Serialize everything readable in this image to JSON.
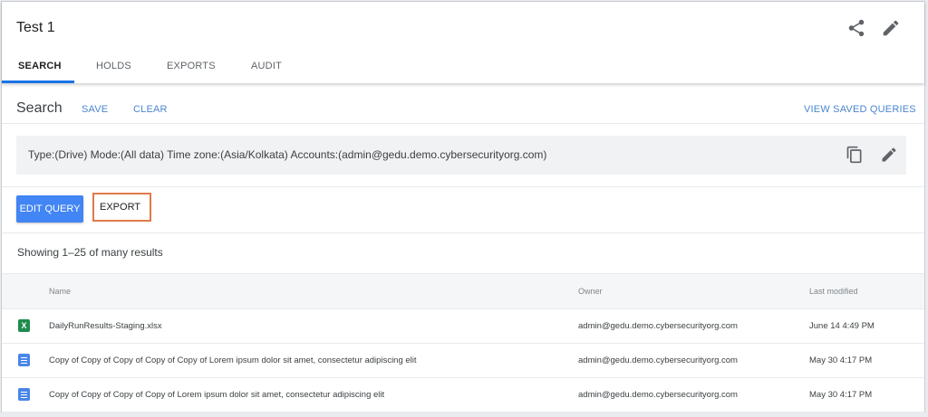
{
  "header": {
    "title": "Test 1",
    "icons": {
      "share": "share-icon",
      "edit": "pencil-icon"
    }
  },
  "tabs": [
    {
      "label": "SEARCH",
      "active": true
    },
    {
      "label": "HOLDS",
      "active": false
    },
    {
      "label": "EXPORTS",
      "active": false
    },
    {
      "label": "AUDIT",
      "active": false
    }
  ],
  "search": {
    "title": "Search",
    "save_label": "SAVE",
    "clear_label": "CLEAR",
    "view_saved_label": "VIEW SAVED QUERIES"
  },
  "query": {
    "text": "Type:(Drive) Mode:(All data) Time zone:(Asia/Kolkata) Accounts:(admin@gedu.demo.cybersecurityorg.com)",
    "icons": {
      "copy": "copy-icon",
      "edit": "pencil-icon"
    }
  },
  "actions": {
    "edit_query_label": "EDIT QUERY",
    "export_label": "EXPORT"
  },
  "results": {
    "count_text": "Showing 1–25 of many results",
    "columns": [
      "Name",
      "Owner",
      "Last modified"
    ],
    "rows": [
      {
        "type": "xlsx",
        "icon_letter": "X",
        "name": "DailyRunResults-Staging.xlsx",
        "owner": "admin@gedu.demo.cybersecurityorg.com",
        "modified": "June 14 4:49 PM"
      },
      {
        "type": "doc",
        "name": "Copy of Copy of Copy of Copy of Copy of Lorem ipsum dolor sit amet, consectetur adipiscing elit",
        "owner": "admin@gedu.demo.cybersecurityorg.com",
        "modified": "May 30 4:17 PM"
      },
      {
        "type": "doc",
        "name": "Copy of Copy of Copy of Copy of Lorem ipsum dolor sit amet, consectetur adipiscing elit",
        "owner": "admin@gedu.demo.cybersecurityorg.com",
        "modified": "May 30 4:17 PM"
      }
    ]
  },
  "colors": {
    "accent": "#1a73e8",
    "primary_button": "#4285f4",
    "link": "#4a86cf",
    "highlight_border": "#e07a4b",
    "xlsx_icon": "#1f8c4e",
    "doc_icon": "#4a86e8"
  }
}
